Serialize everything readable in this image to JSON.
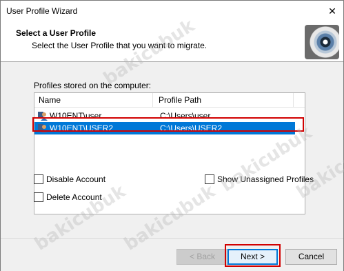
{
  "window": {
    "title": "User Profile Wizard",
    "close_glyph": "✕"
  },
  "header": {
    "title": "Select a User Profile",
    "subtitle": "Select the User Profile that you want to migrate.",
    "image_icon": "eye-icon"
  },
  "profiles": {
    "group_label": "Profiles stored on the computer:",
    "columns": [
      "Name",
      "Profile Path"
    ],
    "rows": [
      {
        "name": "W10ENT\\user",
        "path": "C:\\Users\\user",
        "selected": false
      },
      {
        "name": "W10ENT\\USER2",
        "path": "C:\\Users\\USER2",
        "selected": true
      }
    ]
  },
  "options": {
    "disable_account": {
      "label": "Disable Account",
      "checked": false
    },
    "delete_account": {
      "label": "Delete Account",
      "checked": false
    },
    "show_unassigned": {
      "label": "Show Unassigned Profiles",
      "checked": false
    }
  },
  "buttons": {
    "back": "< Back",
    "next": "Next >",
    "cancel": "Cancel"
  },
  "watermark": "bakicubuk",
  "colors": {
    "selection": "#0078d7",
    "highlight_box": "#d10000"
  }
}
